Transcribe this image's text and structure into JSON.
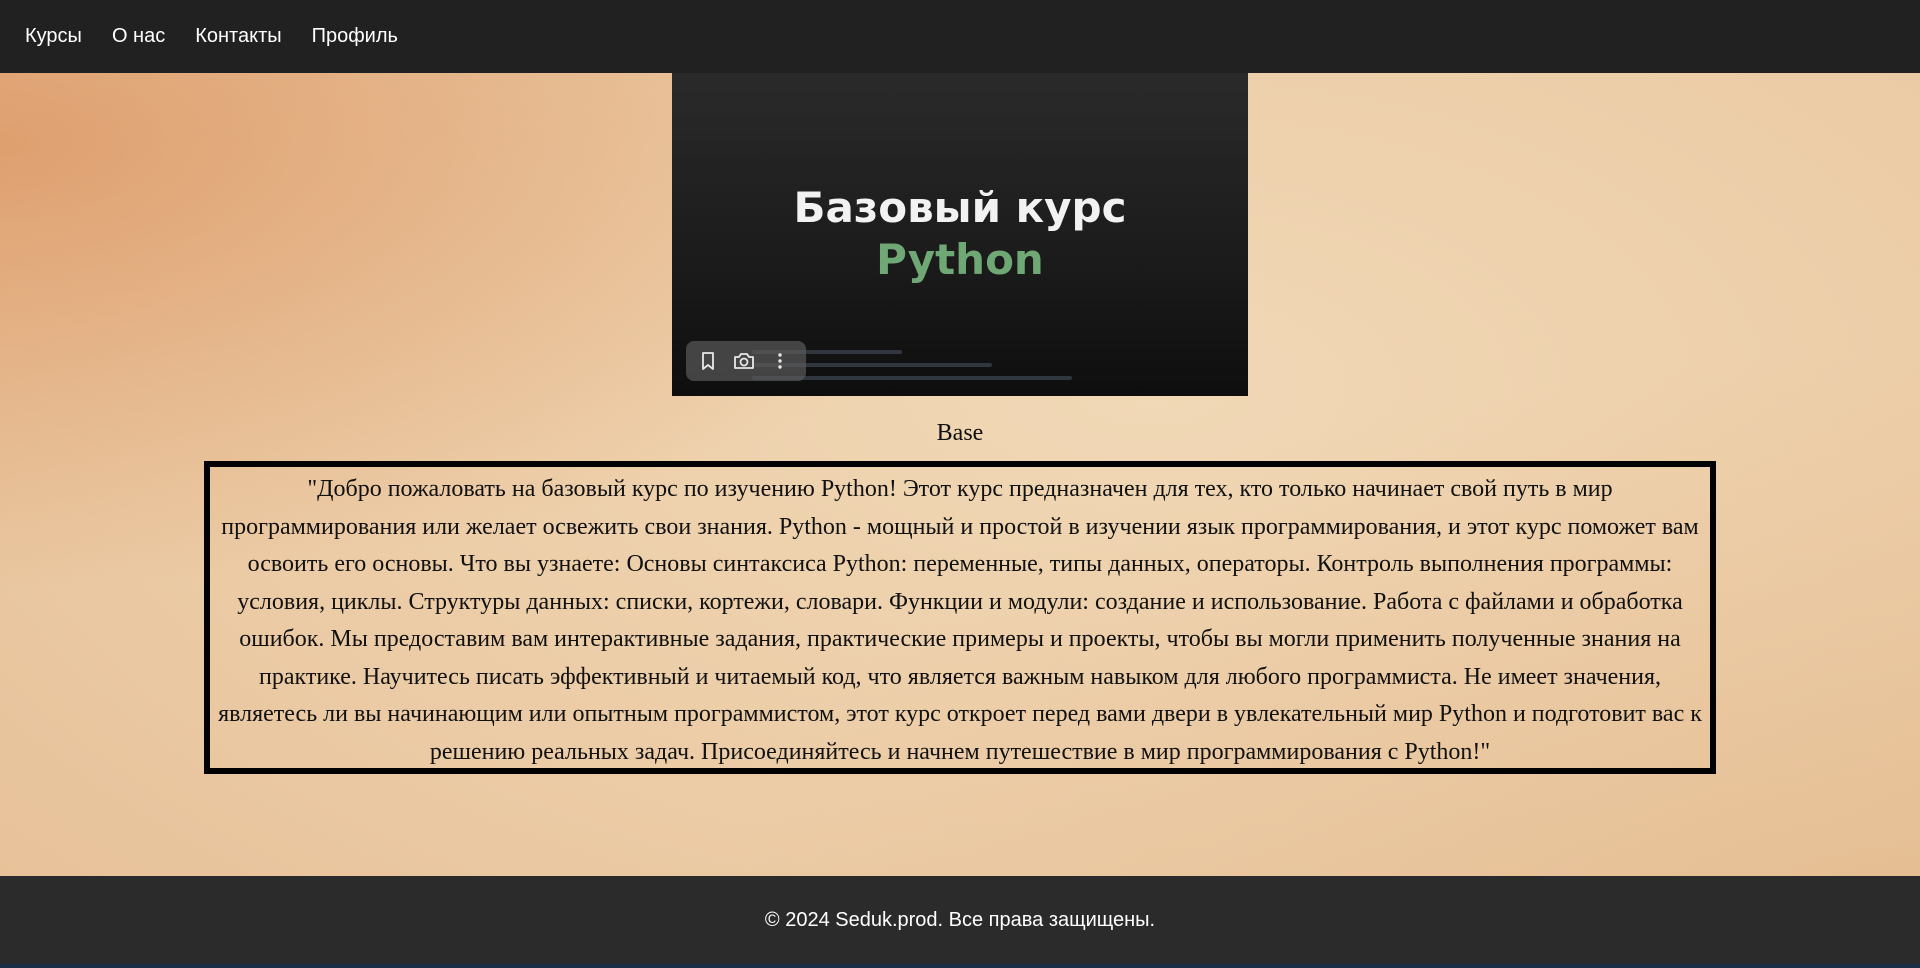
{
  "nav": {
    "items": [
      {
        "label": "Курсы"
      },
      {
        "label": "О нас"
      },
      {
        "label": "Контакты"
      },
      {
        "label": "Профиль"
      }
    ]
  },
  "banner": {
    "title": "Базовый курс",
    "subtitle": "Python",
    "overlay_icons": [
      "bookmark-icon",
      "camera-icon",
      "more-vertical-icon"
    ]
  },
  "course": {
    "name": "Base",
    "description": "\"Добро пожаловать на базовый курс по изучению Python! Этот курс предназначен для тех, кто только начинает свой путь в мир программирования или желает освежить свои знания. Python - мощный и простой в изучении язык программирования, и этот курс поможет вам освоить его основы. Что вы узнаете: Основы синтаксиса Python: переменные, типы данных, операторы. Контроль выполнения программы: условия, циклы. Структуры данных: списки, кортежи, словари. Функции и модули: создание и использование. Работа с файлами и обработка ошибок. Мы предоставим вам интерактивные задания, практические примеры и проекты, чтобы вы могли применить полученные знания на практике. Научитесь писать эффективный и читаемый код, что является важным навыком для любого программиста. Не имеет значения, являетесь ли вы начинающим или опытным программистом, этот курс откроет перед вами двери в увлекательный мир Python и подготовит вас к решению реальных задач. Присоединяйтесь и начнем путешествие в мир программирования с Python!\""
  },
  "footer": {
    "text": "© 2024 Seduk.prod. Все права защищены."
  },
  "colors": {
    "nav_bg": "#212121",
    "footer_bg": "#2b2b2b",
    "accent_green": "#6fa874"
  }
}
